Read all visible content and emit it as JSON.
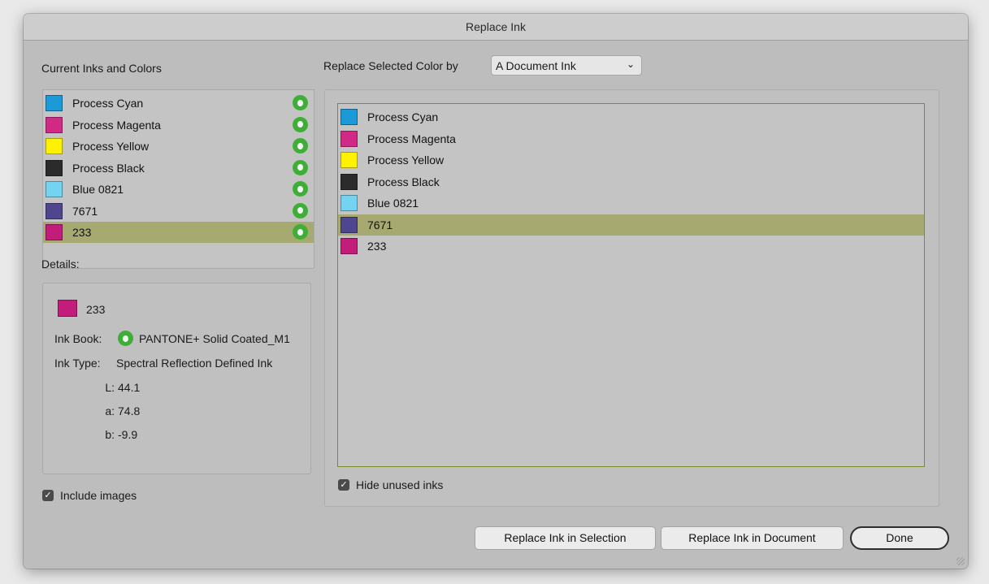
{
  "window": {
    "title": "Replace Ink"
  },
  "left": {
    "header": "Current Inks and Colors",
    "inks": [
      {
        "name": "Process Cyan",
        "color": "#1b9ad7",
        "selected": false
      },
      {
        "name": "Process Magenta",
        "color": "#d02a86",
        "selected": false
      },
      {
        "name": "Process Yellow",
        "color": "#fff200",
        "selected": false
      },
      {
        "name": "Process Black",
        "color": "#2b2b2d",
        "selected": false
      },
      {
        "name": "Blue 0821",
        "color": "#73d3f0",
        "selected": false
      },
      {
        "name": "7671",
        "color": "#4f4690",
        "selected": false
      },
      {
        "name": "233",
        "color": "#c21d7b",
        "selected": true
      }
    ],
    "spot_icon": "spot-color-icon"
  },
  "details": {
    "label": "Details:",
    "ink_name": "233",
    "ink_color": "#c21d7b",
    "ink_book_label": "Ink Book:",
    "ink_book_value": "PANTONE+ Solid Coated_M1",
    "ink_type_label": "Ink Type:",
    "ink_type_value": "Spectral Reflection Defined Ink",
    "l_label": "L:",
    "l_value": "44.1",
    "a_label": "a:",
    "a_value": "74.8",
    "b_label": "b:",
    "b_value": "-9.9"
  },
  "include_images": {
    "label": "Include images",
    "checked": true
  },
  "replace": {
    "label": "Replace Selected Color by",
    "selected_option": "A Document Ink",
    "inks": [
      {
        "name": "Process Cyan",
        "color": "#1b9ad7",
        "selected": false
      },
      {
        "name": "Process Magenta",
        "color": "#d02a86",
        "selected": false
      },
      {
        "name": "Process Yellow",
        "color": "#fff200",
        "selected": false
      },
      {
        "name": "Process Black",
        "color": "#2b2b2d",
        "selected": false
      },
      {
        "name": "Blue 0821",
        "color": "#73d3f0",
        "selected": false
      },
      {
        "name": "7671",
        "color": "#4f4690",
        "selected": true
      },
      {
        "name": "233",
        "color": "#c21d7b",
        "selected": false
      }
    ]
  },
  "hide_unused": {
    "label": "Hide unused inks",
    "checked": true
  },
  "buttons": {
    "replace_selection": "Replace Ink in Selection",
    "replace_document": "Replace Ink in Document",
    "done": "Done"
  }
}
